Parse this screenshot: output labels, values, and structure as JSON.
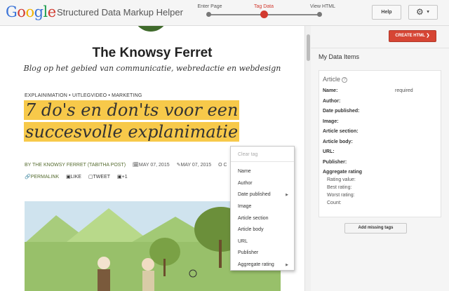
{
  "header": {
    "logo_text": "Google",
    "app_title": "Structured Data Markup Helper",
    "steps": [
      {
        "label": "Enter Page",
        "active": false
      },
      {
        "label": "Tag Data",
        "active": true
      },
      {
        "label": "View HTML",
        "active": false
      }
    ],
    "help_label": "Help",
    "settings_icon": "gear-icon",
    "settings_caret": "▼"
  },
  "page": {
    "blog_title": "The Knowsy Ferret",
    "blog_subtitle": "Blog op het gebied van communicatie, webredactie en webdesign",
    "categories": "EXPLAINIMATION • UITLEGVIDEO • MARKETING",
    "headline_line1": "7 do's en don'ts voor een",
    "headline_line2": "succesvolle explanimatie",
    "author": "BY THE KNOWSY FERRET (TABITHA POST)",
    "date_published": "MAY 07, 2015",
    "date_modified": "MAY 07, 2015",
    "comments": "O C",
    "permalink": "PERMALINK",
    "like": "LIKE",
    "tweet": "TWEET",
    "plus_one": "+1"
  },
  "context_menu": {
    "clear_tag": "Clear tag",
    "items": [
      {
        "label": "Name",
        "submenu": false
      },
      {
        "label": "Author",
        "submenu": false
      },
      {
        "label": "Date published",
        "submenu": true
      },
      {
        "label": "Image",
        "submenu": false
      },
      {
        "label": "Article section",
        "submenu": false
      },
      {
        "label": "Article body",
        "submenu": false
      },
      {
        "label": "URL",
        "submenu": false
      },
      {
        "label": "Publisher",
        "submenu": false
      },
      {
        "label": "Aggregate rating",
        "submenu": true
      }
    ]
  },
  "panel": {
    "create_html_label": "CREATE HTML  ❯",
    "my_data_title": "My Data Items",
    "card_title": "Article",
    "required_label": "required",
    "fields": [
      "Name:",
      "Author:",
      "Date published:",
      "Image:",
      "Article section:",
      "Article body:",
      "URL:",
      "Publisher:",
      "Aggregate rating"
    ],
    "rating_subfields": [
      "Rating value:",
      "Best rating:",
      "Worst rating:",
      "Count:"
    ],
    "add_missing_label": "Add missing tags"
  },
  "colors": {
    "accent_red": "#d64534",
    "highlight_yellow": "#f7c94a",
    "link_green": "#556b2f"
  }
}
